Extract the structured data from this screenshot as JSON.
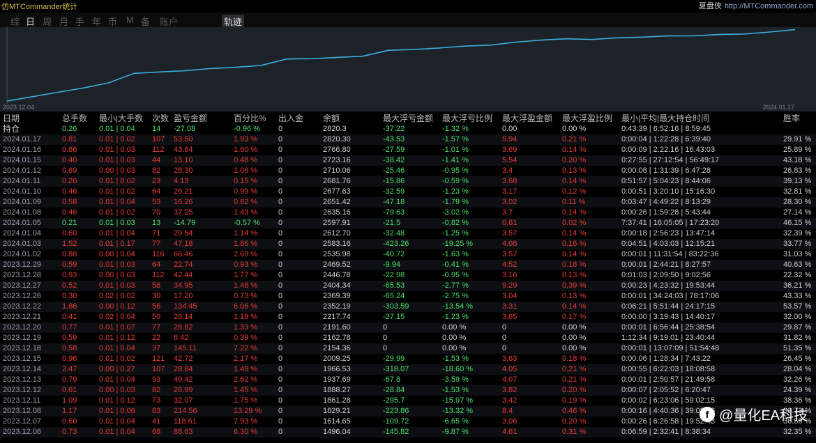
{
  "app_title": "仿MTCommander统计",
  "brand": {
    "name": "夏盘侠",
    "url": "http://MTCommander.com"
  },
  "tabs": [
    "综",
    "日",
    "周",
    "月",
    "手",
    "年",
    "币",
    "M",
    "备",
    "账户"
  ],
  "active_tab": "日",
  "track_tab": "轨迹",
  "chart_data": {
    "type": "line",
    "x_start": "2023.12.04",
    "x_end": "2024.01.17",
    "x": [
      "2023.12.04",
      "2023.12.05",
      "2023.12.06",
      "2023.12.07",
      "2023.12.08",
      "2023.12.11",
      "2023.12.12",
      "2023.12.13",
      "2023.12.14",
      "2023.12.15",
      "2023.12.18",
      "2023.12.19",
      "2023.12.20",
      "2023.12.21",
      "2023.12.22",
      "2023.12.26",
      "2023.12.27",
      "2023.12.28",
      "2023.12.29",
      "2024.01.02",
      "2024.01.03",
      "2024.01.04",
      "2024.01.05",
      "2024.01.08",
      "2024.01.09",
      "2024.01.10",
      "2024.01.11",
      "2024.01.12",
      "2024.01.15",
      "2024.01.16",
      "2024.01.17"
    ],
    "values": [
      1200,
      1300,
      1400,
      1496.04,
      1614.65,
      1829.21,
      1861.28,
      1888.27,
      1937.69,
      1966.53,
      2009.25,
      2154.36,
      2162.78,
      2191.6,
      2217.74,
      2352.19,
      2369.39,
      2404.34,
      2446.78,
      2469.52,
      2535.98,
      2583.16,
      2612.7,
      2597.91,
      2635.16,
      2651.42,
      2677.63,
      2681.76,
      2710.06,
      2723.16,
      2766.8,
      2820.3
    ],
    "line_color": "#3aaee0"
  },
  "headers": [
    "日期",
    "总手数",
    "最小|大手数",
    "次数",
    "盈亏金额",
    "百分比%",
    "出入金",
    "余额",
    "最大浮亏金额",
    "最大浮亏比例",
    "最大浮盈金额",
    "最大浮盈比例",
    "最小|平均|最大持仓时间",
    "胜率"
  ],
  "holding": {
    "label": "持仓",
    "lots": "0.26",
    "minmax": "0.01 | 0.04",
    "count": "14",
    "pnl": "-27.08",
    "pct": "-0.96 %",
    "inout": "0",
    "balance": "2820.3",
    "maxloss": "-37.22",
    "maxloss_pct": "-1.32 %",
    "maxprofit": "0.00",
    "maxprofit_pct": "0.00 %",
    "time": "0:43:39 | 6:52:16 | 8:59:45",
    "win": ""
  },
  "rows": [
    {
      "date": "2024.01.17",
      "lots": "0.81",
      "minmax": "0.01 | 0.02",
      "count": "107",
      "pnl": "53.50",
      "pct": "1.93 %",
      "inout": "0",
      "balance": "2820.30",
      "maxloss": "-43.53",
      "maxloss_pct": "-1.57 %",
      "maxprofit": "5.94",
      "maxprofit_pct": "0.21 %",
      "time": "0:00:04 | 1:22:28 | 6:39:40",
      "win": "29.91 %",
      "neg": false
    },
    {
      "date": "2024.01.16",
      "lots": "0.86",
      "minmax": "0.01 | 0.03",
      "count": "112",
      "pnl": "43.64",
      "pct": "1.60 %",
      "inout": "0",
      "balance": "2766.80",
      "maxloss": "-27.59",
      "maxloss_pct": "-1.01 %",
      "maxprofit": "3.69",
      "maxprofit_pct": "0.14 %",
      "time": "0:00:09 | 2:22:16 | 16:43:03",
      "win": "25.89 %",
      "neg": false
    },
    {
      "date": "2024.01.15",
      "lots": "0.40",
      "minmax": "0.01 | 0.03",
      "count": "44",
      "pnl": "13.10",
      "pct": "0.48 %",
      "inout": "0",
      "balance": "2723.16",
      "maxloss": "-38.42",
      "maxloss_pct": "-1.41 %",
      "maxprofit": "5.54",
      "maxprofit_pct": "0.20 %",
      "time": "0:27:55 | 27:12:54 | 56:49:17",
      "win": "43.18 %",
      "neg": false
    },
    {
      "date": "2024.01.12",
      "lots": "0.69",
      "minmax": "0.00 | 0.03",
      "count": "82",
      "pnl": "28.30",
      "pct": "1.06 %",
      "inout": "0",
      "balance": "2710.06",
      "maxloss": "-25.46",
      "maxloss_pct": "-0.95 %",
      "maxprofit": "3.4",
      "maxprofit_pct": "0.13 %",
      "time": "0:00:08 | 1:31:39 | 6:47:28",
      "win": "26.83 %",
      "neg": false
    },
    {
      "date": "2024.01.11",
      "lots": "0.26",
      "minmax": "0.01 | 0.02",
      "count": "23",
      "pnl": "4.13",
      "pct": "0.15 %",
      "inout": "0",
      "balance": "2681.76",
      "maxloss": "-15.86",
      "maxloss_pct": "-0.59 %",
      "maxprofit": "3.68",
      "maxprofit_pct": "0.14 %",
      "time": "0:51:57 | 5:04:23 | 8:44:06",
      "win": "39.13 %",
      "neg": false
    },
    {
      "date": "2024.01.10",
      "lots": "0.46",
      "minmax": "0.01 | 0.02",
      "count": "64",
      "pnl": "26.21",
      "pct": "0.99 %",
      "inout": "0",
      "balance": "2677.63",
      "maxloss": "-32.59",
      "maxloss_pct": "-1.23 %",
      "maxprofit": "3.17",
      "maxprofit_pct": "0.12 %",
      "time": "0:00:51 | 3:20:10 | 15:16:30",
      "win": "32.81 %",
      "neg": false
    },
    {
      "date": "2024.01.09",
      "lots": "0.58",
      "minmax": "0.01 | 0.04",
      "count": "53",
      "pnl": "16.26",
      "pct": "0.62 %",
      "inout": "0",
      "balance": "2651.42",
      "maxloss": "-47.18",
      "maxloss_pct": "-1.79 %",
      "maxprofit": "3.02",
      "maxprofit_pct": "0.11 %",
      "time": "0:03:47 | 4:49:22 | 8:13:29",
      "win": "28.30 %",
      "neg": false
    },
    {
      "date": "2024.01.08",
      "lots": "0.46",
      "minmax": "0.01 | 0.02",
      "count": "70",
      "pnl": "37.25",
      "pct": "1.43 %",
      "inout": "0",
      "balance": "2635.16",
      "maxloss": "-79.63",
      "maxloss_pct": "-3.02 %",
      "maxprofit": "3.7",
      "maxprofit_pct": "0.14 %",
      "time": "0:00:26 | 1:59:28 | 5:43:44",
      "win": "27.14 %",
      "neg": false
    },
    {
      "date": "2024.01.05",
      "lots": "0.21",
      "minmax": "0.01 | 0.03",
      "count": "13",
      "pnl": "-14.79",
      "pct": "-0.57 %",
      "inout": "0",
      "balance": "2597.91",
      "maxloss": "-21.5",
      "maxloss_pct": "-0.82 %",
      "maxprofit": "0.61",
      "maxprofit_pct": "0.02 %",
      "time": "7:37:41 | 16:05:05 | 17:23:20",
      "win": "46.15 %",
      "neg": true
    },
    {
      "date": "2024.01.04",
      "lots": "0.60",
      "minmax": "0.01 | 0.04",
      "count": "71",
      "pnl": "29.54",
      "pct": "1.14 %",
      "inout": "0",
      "balance": "2612.70",
      "maxloss": "-32.48",
      "maxloss_pct": "-1.25 %",
      "maxprofit": "3.57",
      "maxprofit_pct": "0.14 %",
      "time": "0:00:18 | 2:56:23 | 13:47:14",
      "win": "32.39 %",
      "neg": false
    },
    {
      "date": "2024.01.03",
      "lots": "1.52",
      "minmax": "0.01 | 0.17",
      "count": "77",
      "pnl": "47.18",
      "pct": "1.86 %",
      "inout": "0",
      "balance": "2583.16",
      "maxloss": "-423.26",
      "maxloss_pct": "-19.25 %",
      "maxprofit": "4.08",
      "maxprofit_pct": "0.16 %",
      "time": "0:04:51 | 4:03:03 | 12:15:21",
      "win": "33.77 %",
      "neg": false
    },
    {
      "date": "2024.01.02",
      "lots": "0.88",
      "minmax": "0.00 | 0.04",
      "count": "116",
      "pnl": "66.46",
      "pct": "2.69 %",
      "inout": "0",
      "balance": "2535.98",
      "maxloss": "-40.72",
      "maxloss_pct": "-1.63 %",
      "maxprofit": "3.57",
      "maxprofit_pct": "0.14 %",
      "time": "0:00:01 | 11:31:54 | 83:22:36",
      "win": "31.03 %",
      "neg": false
    },
    {
      "date": "2023.12.29",
      "lots": "0.59",
      "minmax": "0.01 | 0.03",
      "count": "64",
      "pnl": "22.74",
      "pct": "0.93 %",
      "inout": "0",
      "balance": "2469.52",
      "maxloss": "-9.94",
      "maxloss_pct": "-0.41 %",
      "maxprofit": "4.52",
      "maxprofit_pct": "0.18 %",
      "time": "0:00:01 | 2:44:21 | 8:27:57",
      "win": "40.63 %",
      "neg": false
    },
    {
      "date": "2023.12.28",
      "lots": "0.93",
      "minmax": "0.00 | 0.03",
      "count": "112",
      "pnl": "42.44",
      "pct": "1.77 %",
      "inout": "0",
      "balance": "2446.78",
      "maxloss": "-22.98",
      "maxloss_pct": "-0.95 %",
      "maxprofit": "3.16",
      "maxprofit_pct": "0.13 %",
      "time": "0:01:03 | 2:09:50 | 9:02:56",
      "win": "22.32 %",
      "neg": false
    },
    {
      "date": "2023.12.27",
      "lots": "0.52",
      "minmax": "0.01 | 0.03",
      "count": "58",
      "pnl": "34.95",
      "pct": "1.48 %",
      "inout": "0",
      "balance": "2404.34",
      "maxloss": "-65.53",
      "maxloss_pct": "-2.77 %",
      "maxprofit": "9.29",
      "maxprofit_pct": "0.39 %",
      "time": "0:00:23 | 4:23:32 | 19:53:44",
      "win": "36.21 %",
      "neg": false
    },
    {
      "date": "2023.12.26",
      "lots": "0.30",
      "minmax": "0.02 | 0.02",
      "count": "30",
      "pnl": "17.20",
      "pct": "0.73 %",
      "inout": "0",
      "balance": "2369.39",
      "maxloss": "-65.24",
      "maxloss_pct": "-2.75 %",
      "maxprofit": "3.04",
      "maxprofit_pct": "0.13 %",
      "time": "0:00:01 | 34:24:03 | 78:17:06",
      "win": "43.33 %",
      "neg": false
    },
    {
      "date": "2023.12.22",
      "lots": "1.86",
      "minmax": "0.00 | 0.12",
      "count": "56",
      "pnl": "134.45",
      "pct": "6.06 %",
      "inout": "0",
      "balance": "2352.19",
      "maxloss": "-303.59",
      "maxloss_pct": "-13.54 %",
      "maxprofit": "3.31",
      "maxprofit_pct": "0.14 %",
      "time": "0:06:21 | 5:51:44 | 24:17:15",
      "win": "53.57 %",
      "neg": false
    },
    {
      "date": "2023.12.21",
      "lots": "0.41",
      "minmax": "0.02 | 0.04",
      "count": "50",
      "pnl": "26.14",
      "pct": "1.19 %",
      "inout": "0",
      "balance": "2217.74",
      "maxloss": "-27.15",
      "maxloss_pct": "-1.23 %",
      "maxprofit": "3.65",
      "maxprofit_pct": "0.17 %",
      "time": "0:00:00 | 3:19:43 | 14:40:17",
      "win": "32.00 %",
      "neg": false
    },
    {
      "date": "2023.12.20",
      "lots": "0.77",
      "minmax": "0.01 | 0.07",
      "count": "77",
      "pnl": "28.82",
      "pct": "1.33 %",
      "inout": "0",
      "balance": "2191.60",
      "maxloss": "0",
      "maxloss_pct": "0.00 %",
      "maxprofit": "0",
      "maxprofit_pct": "0.00 %",
      "time": "0:00:01 | 6:56:44 | 25:38:54",
      "win": "29.87 %",
      "neg": false
    },
    {
      "date": "2023.12.19",
      "lots": "0.59",
      "minmax": "0.01 | 0.12",
      "count": "22",
      "pnl": "8.42",
      "pct": "0.39 %",
      "inout": "0",
      "balance": "2162.78",
      "maxloss": "0",
      "maxloss_pct": "0.00 %",
      "maxprofit": "0",
      "maxprofit_pct": "0.00 %",
      "time": "1:12:34 | 9:19:01 | 23:40:44",
      "win": "31.82 %",
      "neg": false
    },
    {
      "date": "2023.12.18",
      "lots": "0.58",
      "minmax": "0.01 | 0.04",
      "count": "37",
      "pnl": "145.11",
      "pct": "7.22 %",
      "inout": "0",
      "balance": "2154.36",
      "maxloss": "0",
      "maxloss_pct": "0.00 %",
      "maxprofit": "0",
      "maxprofit_pct": "0.00 %",
      "time": "0:00:01 | 13:07:09 | 51:54:48",
      "win": "51.35 %",
      "neg": false
    },
    {
      "date": "2023.12.15",
      "lots": "0.96",
      "minmax": "0.01 | 0.02",
      "count": "121",
      "pnl": "42.72",
      "pct": "2.17 %",
      "inout": "0",
      "balance": "2009.25",
      "maxloss": "-29.99",
      "maxloss_pct": "-1.53 %",
      "maxprofit": "3.63",
      "maxprofit_pct": "0.18 %",
      "time": "0:00:06 | 1:28:34 | 7:43:22",
      "win": "26.45 %",
      "neg": false
    },
    {
      "date": "2023.12.14",
      "lots": "2.47",
      "minmax": "0.00 | 0.27",
      "count": "107",
      "pnl": "28.84",
      "pct": "1.49 %",
      "inout": "0",
      "balance": "1966.53",
      "maxloss": "-318.07",
      "maxloss_pct": "-18.60 %",
      "maxprofit": "4.05",
      "maxprofit_pct": "0.21 %",
      "time": "0:00:55 | 6:22:03 | 18:08:58",
      "win": "28.04 %",
      "neg": false
    },
    {
      "date": "2023.12.13",
      "lots": "0.79",
      "minmax": "0.01 | 0.04",
      "count": "93",
      "pnl": "49.42",
      "pct": "2.62 %",
      "inout": "0",
      "balance": "1937.69",
      "maxloss": "-67.8",
      "maxloss_pct": "-3.59 %",
      "maxprofit": "4.07",
      "maxprofit_pct": "0.21 %",
      "time": "0:00:01 | 2:50:57 | 21:49:58",
      "win": "32.26 %",
      "neg": false
    },
    {
      "date": "2023.12.12",
      "lots": "0.61",
      "minmax": "0.00 | 0.03",
      "count": "82",
      "pnl": "26.99",
      "pct": "1.45 %",
      "inout": "0",
      "balance": "1888.27",
      "maxloss": "-28.84",
      "maxloss_pct": "-1.53 %",
      "maxprofit": "3.82",
      "maxprofit_pct": "0.20 %",
      "time": "0:00:07 | 2:05:52 | 6:20:47",
      "win": "24.39 %",
      "neg": false
    },
    {
      "date": "2023.12.11",
      "lots": "1.09",
      "minmax": "0.01 | 0.12",
      "count": "73",
      "pnl": "32.07",
      "pct": "1.75 %",
      "inout": "0",
      "balance": "1861.28",
      "maxloss": "-295.7",
      "maxloss_pct": "-15.97 %",
      "maxprofit": "3.42",
      "maxprofit_pct": "0.19 %",
      "time": "0:00:02 | 6:23:06 | 59:02:15",
      "win": "38.36 %",
      "neg": false
    },
    {
      "date": "2023.12.08",
      "lots": "1.17",
      "minmax": "0.01 | 0.06",
      "count": "83",
      "pnl": "214.56",
      "pct": "13.29 %",
      "inout": "0",
      "balance": "1829.21",
      "maxloss": "-223.86",
      "maxloss_pct": "-13.32 %",
      "maxprofit": "8.4",
      "maxprofit_pct": "0.46 %",
      "time": "0:00:16 | 4:40:36 | 39:08:06",
      "win": "33.73 %",
      "neg": false
    },
    {
      "date": "2023.12.07",
      "lots": "0.60",
      "minmax": "0.01 | 0.04",
      "count": "41",
      "pnl": "118.61",
      "pct": "7.93 %",
      "inout": "0",
      "balance": "1614.65",
      "maxloss": "-109.72",
      "maxloss_pct": "-6.65 %",
      "maxprofit": "3.06",
      "maxprofit_pct": "0.20 %",
      "time": "0:00:26 | 6:26:58 | 19:52:43",
      "win": "36.59 %",
      "neg": false
    },
    {
      "date": "2023.12.06",
      "lots": "0.73",
      "minmax": "0.01 | 0.04",
      "count": "68",
      "pnl": "88.63",
      "pct": "6.30 %",
      "inout": "0",
      "balance": "1496.04",
      "maxloss": "-145.82",
      "maxloss_pct": "-9.87 %",
      "maxprofit": "4.61",
      "maxprofit_pct": "0.31 %",
      "time": "0:06:59 | 2:32:41 | 8:38:34",
      "win": "32.35 %",
      "neg": false
    }
  ],
  "watermark": "@量化EA科技"
}
